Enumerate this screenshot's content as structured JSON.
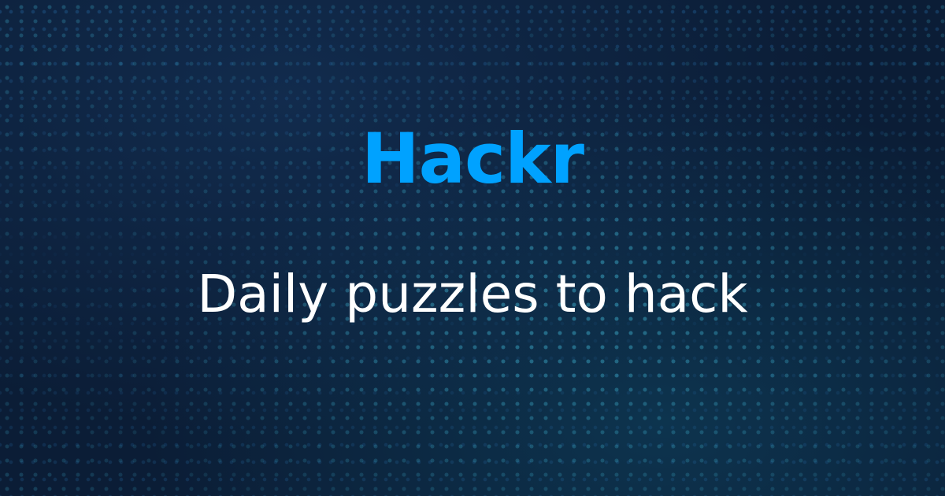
{
  "brand": {
    "name": "Hackr",
    "color": "#00a2ff"
  },
  "tagline": "Daily puzzles to hack"
}
